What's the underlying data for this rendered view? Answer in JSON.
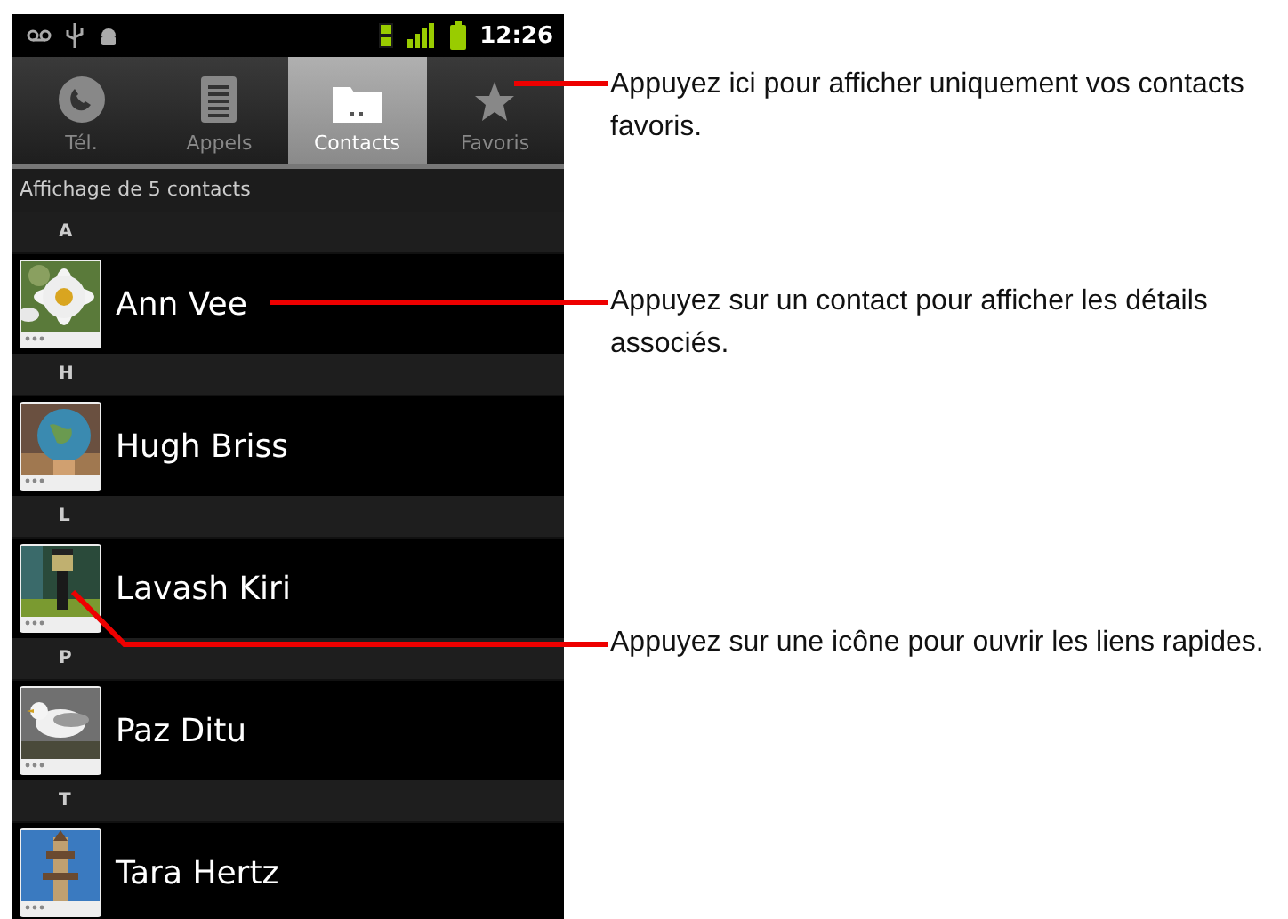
{
  "status_bar": {
    "time": "12:26"
  },
  "tabs": [
    {
      "label": "Tél.",
      "kind": "phone",
      "selected": false
    },
    {
      "label": "Appels",
      "kind": "list",
      "selected": false
    },
    {
      "label": "Contacts",
      "kind": "folder",
      "selected": true
    },
    {
      "label": "Favoris",
      "kind": "star",
      "selected": false
    }
  ],
  "list_info": "Affichage de 5 contacts",
  "sections": [
    {
      "letter": "A",
      "contacts": [
        {
          "name": "Ann Vee"
        }
      ]
    },
    {
      "letter": "H",
      "contacts": [
        {
          "name": "Hugh Briss"
        }
      ]
    },
    {
      "letter": "L",
      "contacts": [
        {
          "name": "Lavash Kiri"
        }
      ]
    },
    {
      "letter": "P",
      "contacts": [
        {
          "name": "Paz Ditu"
        }
      ]
    },
    {
      "letter": "T",
      "contacts": [
        {
          "name": "Tara Hertz"
        }
      ]
    }
  ],
  "callouts": [
    {
      "text": "Appuyez ici pour afficher uniquement vos contacts favoris."
    },
    {
      "text": "Appuyez sur un contact pour afficher les détails associés."
    },
    {
      "text": "Appuyez sur une icône pour ouvrir les liens rapides."
    }
  ]
}
